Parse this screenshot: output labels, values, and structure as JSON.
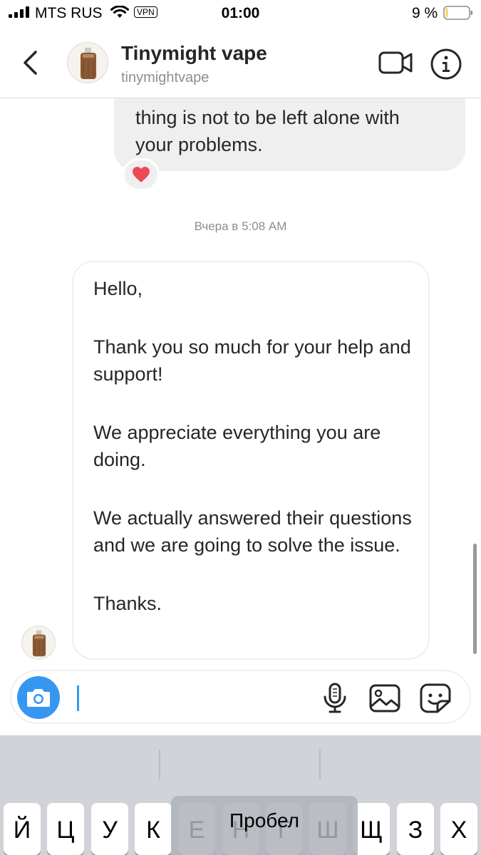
{
  "status_bar": {
    "carrier": "MTS RUS",
    "vpn_label": "VPN",
    "time": "01:00",
    "battery_percent": "9 %",
    "battery_level": 0.09
  },
  "header": {
    "title": "Tinymight vape",
    "username": "tinymightvape"
  },
  "messages": {
    "sent_text": "thing is not to be left alone with\nyour problems.",
    "reaction": "heart",
    "timestamp": "Вчера в 5:08 AM",
    "received_paragraphs": [
      "Hello,",
      "Thank you so much for your help and support!",
      "We appreciate everything you are doing.",
      "We actually answered their questions and we are going to solve the issue.",
      "Thanks."
    ]
  },
  "composer": {
    "input_value": ""
  },
  "keyboard": {
    "space_label": "Пробел",
    "keys": [
      "Й",
      "Ц",
      "У",
      "К",
      "Е",
      "Н",
      "Г",
      "Ш",
      "Щ",
      "З",
      "Х"
    ]
  },
  "colors": {
    "accent": "#3797f0",
    "bubble_gray": "#efefef",
    "secondary_text": "#8e8e8e",
    "heart": "#ed4956",
    "keyboard_bg": "#d1d3d9"
  }
}
